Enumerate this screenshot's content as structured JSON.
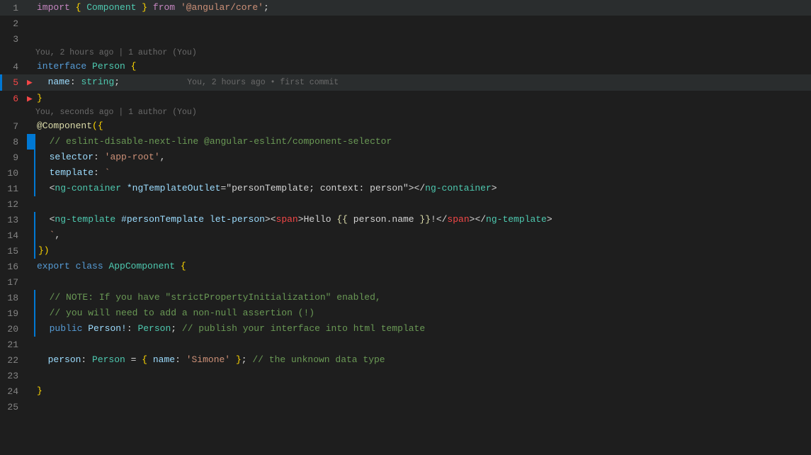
{
  "editor": {
    "lines": [
      {
        "num": 1,
        "content": "import_line",
        "blame": null,
        "git": null
      },
      {
        "num": 2,
        "content": "empty",
        "blame": null,
        "git": null
      },
      {
        "num": 3,
        "content": "empty",
        "blame": null,
        "git": null
      },
      {
        "num": 4,
        "content": "interface_line",
        "blame": "You, 2 hours ago | 1 author (You)",
        "git": null
      },
      {
        "num": 5,
        "content": "name_line",
        "blame": null,
        "git": "red"
      },
      {
        "num": 6,
        "content": "close_brace",
        "blame": null,
        "git": "red"
      },
      {
        "num": 7,
        "content": "component_line",
        "blame": "You, seconds ago | 1 author (You)",
        "git": null
      },
      {
        "num": 8,
        "content": "eslint_comment",
        "blame": null,
        "git": "blue"
      },
      {
        "num": 9,
        "content": "selector_line",
        "blame": null,
        "git": "blue"
      },
      {
        "num": 10,
        "content": "template_line",
        "blame": null,
        "git": "blue"
      },
      {
        "num": 11,
        "content": "ng_container_line",
        "blame": null,
        "git": "blue"
      },
      {
        "num": 12,
        "content": "empty",
        "blame": null,
        "git": "blue"
      },
      {
        "num": 13,
        "content": "ng_template_line",
        "blame": null,
        "git": "blue"
      },
      {
        "num": 14,
        "content": "backtick_comma",
        "blame": null,
        "git": "blue"
      },
      {
        "num": 15,
        "content": "close_bracket",
        "blame": null,
        "git": "blue"
      },
      {
        "num": 16,
        "content": "export_class",
        "blame": null,
        "git": null
      },
      {
        "num": 17,
        "content": "empty",
        "blame": null,
        "git": null
      },
      {
        "num": 18,
        "content": "comment1",
        "blame": null,
        "git": "blue"
      },
      {
        "num": 19,
        "content": "comment2",
        "blame": null,
        "git": "blue"
      },
      {
        "num": 20,
        "content": "public_person",
        "blame": null,
        "git": "blue"
      },
      {
        "num": 21,
        "content": "empty",
        "blame": null,
        "git": null
      },
      {
        "num": 22,
        "content": "person_line",
        "blame": null,
        "git": null
      },
      {
        "num": 23,
        "content": "empty",
        "blame": null,
        "git": null
      },
      {
        "num": 24,
        "content": "close_brace2",
        "blame": null,
        "git": null
      },
      {
        "num": 25,
        "content": "empty",
        "blame": null,
        "git": null
      }
    ],
    "inline_blame": {
      "line5": "You, 2 hours ago • first commit"
    }
  }
}
